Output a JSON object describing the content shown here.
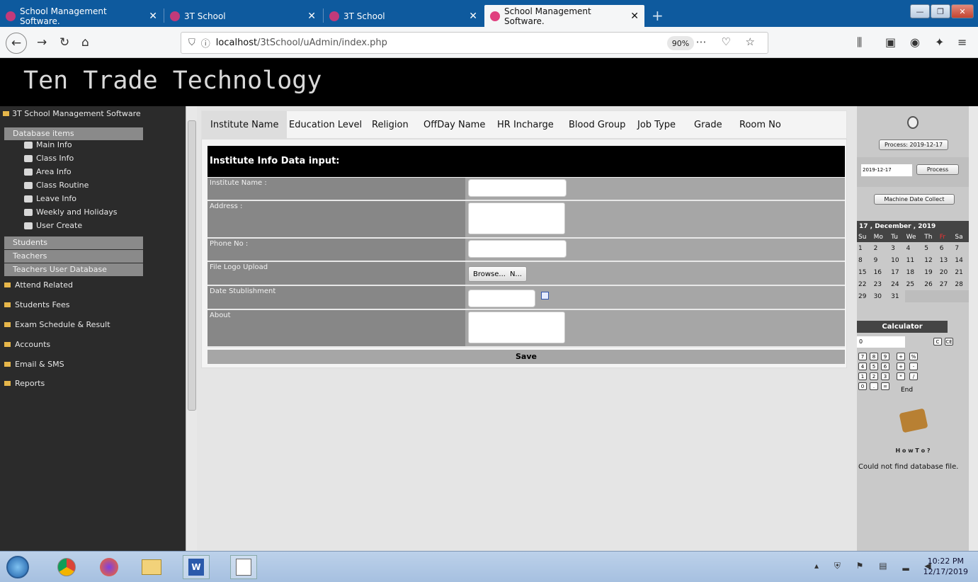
{
  "browser": {
    "tabs": [
      {
        "title": "School Management Software.",
        "close": "✕"
      },
      {
        "title": "3T School",
        "close": "✕"
      },
      {
        "title": "3T School",
        "close": "✕"
      },
      {
        "title": "School Management Software.",
        "close": "✕"
      }
    ],
    "new_tab": "+",
    "url_prefix": "localhost",
    "url_path": "/3tSchool/uAdmin/index.php",
    "zoom": "90%"
  },
  "banner": {
    "title": "Ten Trade Technology"
  },
  "sidebar": {
    "root": "3T School Management Software",
    "db_band": "Database items",
    "db_items": [
      "Main Info",
      "Class Info",
      "Area Info",
      "Class Routine",
      "Leave Info",
      "Weekly and Holidays",
      "User Create"
    ],
    "bands": [
      "Students",
      "Teachers",
      "Teachers User Database"
    ],
    "folders": [
      "Attend Related",
      "Students Fees",
      "Exam Schedule & Result",
      "Accounts",
      "Email & SMS",
      "Reports"
    ]
  },
  "main": {
    "tabs": [
      "Institute Name",
      "Education Level",
      "Religion",
      "OffDay Name",
      "HR Incharge",
      "Blood Group",
      "Job Type",
      "Grade",
      "Room No"
    ],
    "form_title": "Institute Info Data input:",
    "fields": {
      "institute_name": "Institute Name :",
      "address": "Address :",
      "phone": "Phone No :",
      "logo": "File Logo Upload",
      "date": "Date Stublishment",
      "about": "About"
    },
    "browse_label": "Browse...",
    "file_status": "N...",
    "save_label": "Save"
  },
  "right": {
    "process_top": "Process: 2019-12-17",
    "date_value": "2019-12-17",
    "process_btn": "Process",
    "machine_btn": "Machine Date Collect",
    "cal_header": "17 , December , 2019",
    "weekdays": [
      "Su",
      "Mo",
      "Tu",
      "We",
      "Th",
      "Fr",
      "Sa"
    ],
    "weeks": [
      [
        "1",
        "2",
        "3",
        "4",
        "5",
        "6",
        "7"
      ],
      [
        "8",
        "9",
        "10",
        "11",
        "12",
        "13",
        "14"
      ],
      [
        "15",
        "16",
        "17",
        "18",
        "19",
        "20",
        "21"
      ],
      [
        "22",
        "23",
        "24",
        "25",
        "26",
        "27",
        "28"
      ],
      [
        "29",
        "30",
        "31",
        "",
        "",
        "",
        ""
      ]
    ],
    "calc_title": "Calculator",
    "calc_display": "0",
    "calc_c": "C",
    "calc_ce": "CE",
    "calc_end": "End",
    "howto": "H o w  T o ?",
    "error": "Could not find database file."
  },
  "taskbar": {
    "time": "10:22 PM",
    "date": "12/17/2019"
  }
}
